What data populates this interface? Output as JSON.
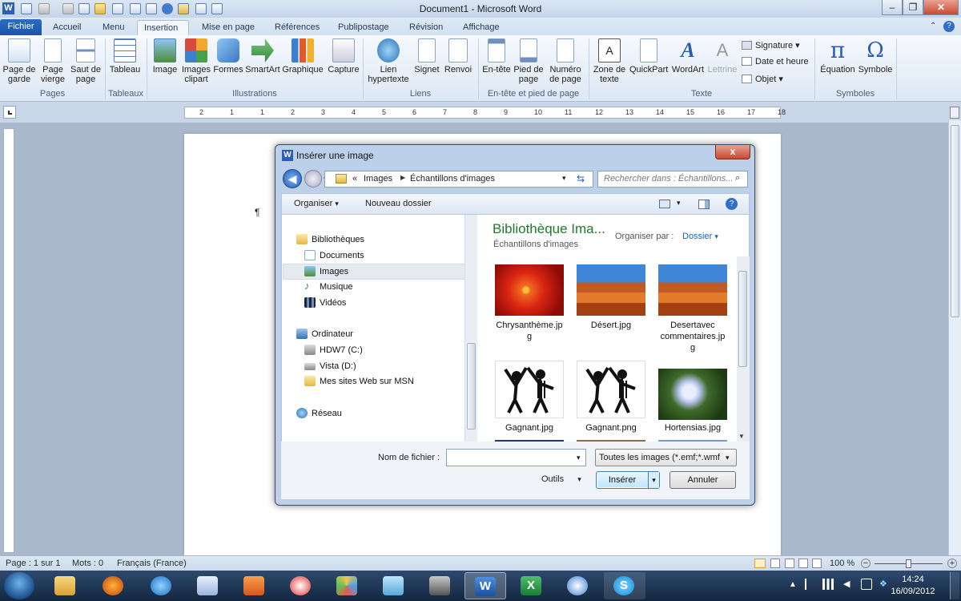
{
  "window": {
    "title": "Document1 - Microsoft Word",
    "app_letter": "W"
  },
  "tabs": [
    "Fichier",
    "Accueil",
    "Menu",
    "Insertion",
    "Mise en page",
    "Références",
    "Publipostage",
    "Révision",
    "Affichage"
  ],
  "ribbon": {
    "pages": {
      "b1": "Page de",
      "b1b": "garde",
      "b2": "Page",
      "b2b": "vierge",
      "b3": "Saut de",
      "b3b": "page",
      "group": "Pages"
    },
    "tableaux": {
      "b1": "Tableau",
      "group": "Tableaux"
    },
    "illustrations": {
      "b1": "Image",
      "b2": "Images",
      "b2b": "clipart",
      "b3": "Formes",
      "b4": "SmartArt",
      "b5": "Graphique",
      "b6": "Capture",
      "group": "Illustrations"
    },
    "liens": {
      "b1": "Lien",
      "b1b": "hypertexte",
      "b2": "Signet",
      "b3": "Renvoi",
      "group": "Liens"
    },
    "entete": {
      "b1": "En-tête",
      "b2": "Pied de",
      "b2b": "page",
      "b3": "Numéro",
      "b3b": "de page",
      "group": "En-tête et pied de page"
    },
    "texte": {
      "b1": "Zone de",
      "b1b": "texte",
      "b2": "QuickPart",
      "b3": "WordArt",
      "b4": "Lettrine",
      "s1": "Signature",
      "s2": "Date et heure",
      "s3": "Objet",
      "group": "Texte"
    },
    "symboles": {
      "b1": "Équation",
      "b2": "Symbole",
      "group": "Symboles"
    }
  },
  "ruler_numbers": [
    "2",
    "1",
    "1",
    "2",
    "3",
    "4",
    "5",
    "6",
    "7",
    "8",
    "9",
    "10",
    "11",
    "12",
    "13",
    "14",
    "15",
    "16",
    "17",
    "18"
  ],
  "document": {
    "pilcrow": "¶"
  },
  "dialog": {
    "title": "Insérer une image",
    "close": "x",
    "address": {
      "sep": "«",
      "crumb1": "Images",
      "crumb2": "Échantillons d'images"
    },
    "search_placeholder": "Rechercher dans : Échantillons...",
    "organize": "Organiser",
    "new_folder": "Nouveau dossier",
    "nav": {
      "libraries": "Bibliothèques",
      "documents": "Documents",
      "images": "Images",
      "music": "Musique",
      "videos": "Vidéos",
      "computer": "Ordinateur",
      "drive_c": "HDW7 (C:)",
      "drive_d": "Vista (D:)",
      "msn": "Mes sites Web sur MSN",
      "network": "Réseau"
    },
    "library_title": "Bibliothèque Ima...",
    "library_subtitle": "Échantillons d'images",
    "arrange_by_label": "Organiser par :",
    "arrange_by_value": "Dossier",
    "files": [
      {
        "name": "Chrysanthème.jpg",
        "l1": "Chrysanthème.jp",
        "l2": "g",
        "l3": ""
      },
      {
        "name": "Désert.jpg",
        "l1": "Désert.jpg",
        "l2": "",
        "l3": ""
      },
      {
        "name": "Desertavec commentaires.jpg",
        "l1": "Desertavec",
        "l2": "commentaires.jp",
        "l3": "g"
      },
      {
        "name": "Gagnant.jpg",
        "l1": "Gagnant.jpg",
        "l2": "",
        "l3": ""
      },
      {
        "name": "Gagnant.png",
        "l1": "Gagnant.png",
        "l2": "",
        "l3": ""
      },
      {
        "name": "Hortensias.jpg",
        "l1": "Hortensias.jpg",
        "l2": "",
        "l3": ""
      }
    ],
    "filename_label": "Nom de fichier :",
    "filename_value": "",
    "filetype": "Toutes les images (*.emf;*.wmf",
    "tools": "Outils",
    "insert": "Insérer",
    "cancel": "Annuler"
  },
  "status": {
    "page": "Page : 1 sur 1",
    "words": "Mots : 0",
    "language": "Français (France)",
    "zoom": "100 %"
  },
  "taskbar": {
    "time": "14:24",
    "date": "16/09/2012"
  },
  "colors": {
    "ribbon_blue": "#1b54a8",
    "library_title": "#1e7b2e",
    "arrange_value": "#1b5ebf",
    "taskbar": "#1a2f4c"
  }
}
